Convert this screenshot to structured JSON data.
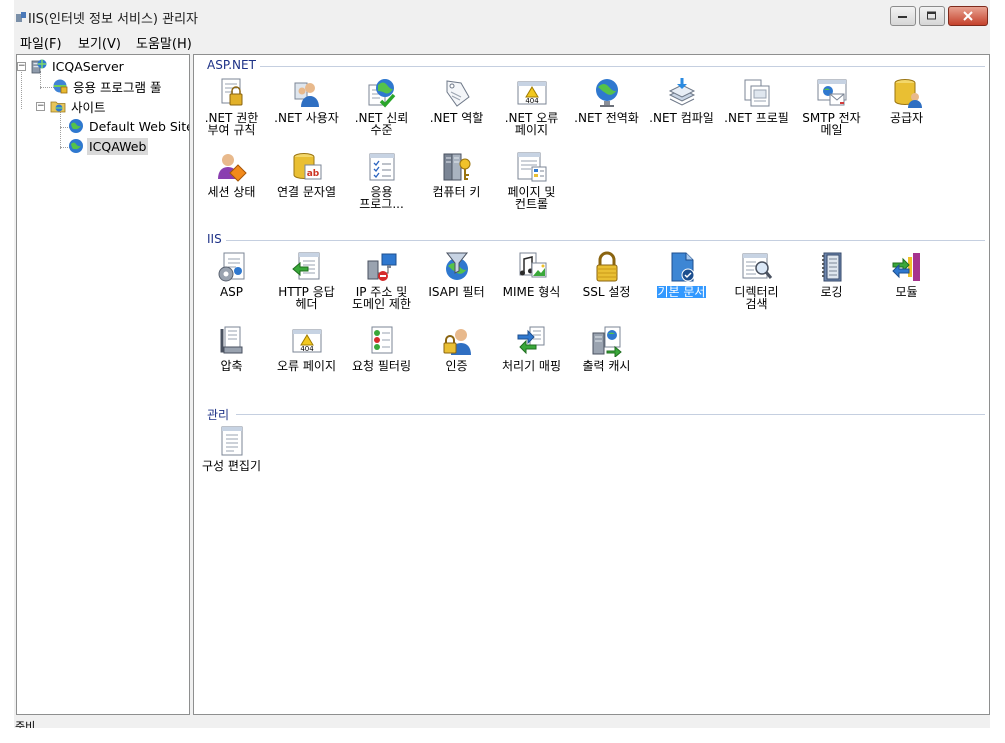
{
  "window": {
    "title": "IIS(인터넷 정보 서비스) 관리자"
  },
  "menu": {
    "items": [
      "파일(F)",
      "보기(V)",
      "도움말(H)"
    ]
  },
  "tree": {
    "server": "ICQAServer",
    "app_pools": "응용 프로그램 풀",
    "sites": "사이트",
    "site_default": "Default Web Site",
    "site_icqa": "ICQAWeb"
  },
  "groups": {
    "aspnet": {
      "title": "ASP.NET",
      "features": [
        {
          "label": ".NET 권한\n부여 규칙",
          "icon": "lock-document-icon"
        },
        {
          "label": ".NET 사용자",
          "icon": "users-icon"
        },
        {
          "label": ".NET 신뢰\n수준",
          "icon": "globe-check-icon"
        },
        {
          "label": ".NET 역할",
          "icon": "role-tag-icon"
        },
        {
          "label": ".NET 오류\n페이지",
          "icon": "error-404-icon"
        },
        {
          "label": ".NET 전역화",
          "icon": "globe-icon"
        },
        {
          "label": ".NET 컴파일",
          "icon": "compile-stack-icon"
        },
        {
          "label": ".NET 프로필",
          "icon": "profile-pages-icon"
        },
        {
          "label": "SMTP 전자\n메일",
          "icon": "smtp-email-icon"
        },
        {
          "label": "공급자",
          "icon": "provider-icon"
        },
        {
          "label": "세션 상태",
          "icon": "session-state-icon"
        },
        {
          "label": "연결 문자열",
          "icon": "connection-string-icon"
        },
        {
          "label": "응용\n프로그...",
          "icon": "app-settings-icon"
        },
        {
          "label": "컴퓨터 키",
          "icon": "machine-key-icon"
        },
        {
          "label": "페이지 및\n컨트롤",
          "icon": "pages-controls-icon"
        }
      ]
    },
    "iis": {
      "title": "IIS",
      "features": [
        {
          "label": "ASP",
          "icon": "asp-icon"
        },
        {
          "label": "HTTP 응답\n헤더",
          "icon": "http-headers-icon"
        },
        {
          "label": "IP 주소 및\n도메인 제한",
          "icon": "ip-restrict-icon"
        },
        {
          "label": "ISAPI 필터",
          "icon": "isapi-filter-icon"
        },
        {
          "label": "MIME 형식",
          "icon": "mime-types-icon"
        },
        {
          "label": "SSL 설정",
          "icon": "ssl-lock-icon"
        },
        {
          "label": "기본 문서",
          "icon": "default-document-icon",
          "selected": true
        },
        {
          "label": "디렉터리\n검색",
          "icon": "directory-browse-icon"
        },
        {
          "label": "로깅",
          "icon": "logging-icon"
        },
        {
          "label": "모듈",
          "icon": "modules-icon"
        },
        {
          "label": "압축",
          "icon": "compression-icon"
        },
        {
          "label": "오류 페이지",
          "icon": "error-pages-icon"
        },
        {
          "label": "요청 필터링",
          "icon": "request-filtering-icon"
        },
        {
          "label": "인증",
          "icon": "authentication-icon"
        },
        {
          "label": "처리기 매핑",
          "icon": "handler-mappings-icon"
        },
        {
          "label": "출력 캐시",
          "icon": "output-cache-icon"
        }
      ]
    },
    "management": {
      "title": "관리",
      "features": [
        {
          "label": "구성 편집기",
          "icon": "config-editor-icon"
        }
      ]
    }
  },
  "statusbar": {
    "text": "준비"
  },
  "colors": {
    "group_title": "#1e3287",
    "selection": "#3399ff"
  }
}
